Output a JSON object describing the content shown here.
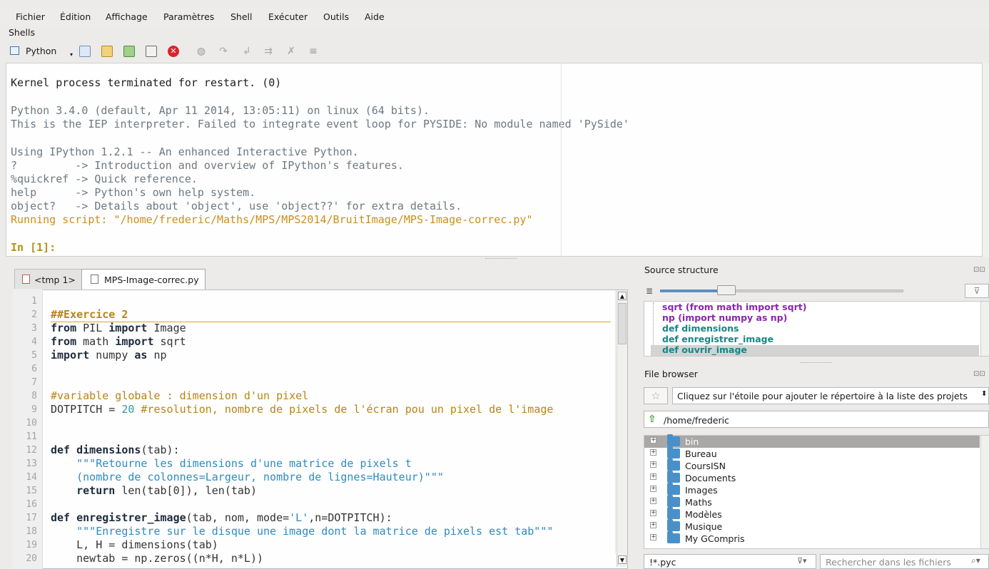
{
  "menu": [
    "Fichier",
    "Édition",
    "Affichage",
    "Paramètres",
    "Shell",
    "Exécuter",
    "Outils",
    "Aide"
  ],
  "shells_label": "Shells",
  "toolbar": {
    "python_label": "Python"
  },
  "shell": {
    "lines": [
      "Kernel process terminated for restart. (0)",
      "Python 3.4.0 (default, Apr 11 2014, 13:05:11) on linux (64 bits).",
      "This is the IEP interpreter. Failed to integrate event loop for PYSIDE: No module named 'PySide'",
      "Using IPython 1.2.1 -- An enhanced Interactive Python.",
      "?         -> Introduction and overview of IPython's features.",
      "%quickref -> Quick reference.",
      "help      -> Python's own help system.",
      "object?   -> Details about 'object', use 'object??' for extra details.",
      "Running script: \"/home/frederic/Maths/MPS/MPS2014/BruitImage/MPS-Image-correc.py\"",
      "In [1]:"
    ]
  },
  "editor": {
    "tabs": [
      "<tmp 1>",
      "MPS-Image-correc.py"
    ],
    "line_numbers": [
      "1",
      "2",
      "3",
      "4",
      "5",
      "6",
      "7",
      "8",
      "9",
      "10",
      "11",
      "12",
      "13",
      "14",
      "15",
      "16",
      "17",
      "18",
      "19",
      "20"
    ],
    "code": {
      "l2": "##Exercice 2",
      "l3a": "from",
      "l3b": " PIL ",
      "l3c": "import",
      "l3d": " Image",
      "l4a": "from",
      "l4b": " math ",
      "l4c": "import",
      "l4d": " sqrt",
      "l5a": "import",
      "l5b": " numpy ",
      "l5c": "as",
      "l5d": " np",
      "l8": "#variable globale : dimension d'un pixel",
      "l9a": "DOTPITCH = ",
      "l9b": "20",
      "l9c": " #resolution, nombre de pixels de l'écran pou un pixel de l'image",
      "l12a": "def ",
      "l12b": "dimensions",
      "l12c": "(tab):",
      "l13": "    \"\"\"Retourne les dimensions d'une matrice de pixels t",
      "l14": "    (nombre de colonnes=Largeur, nombre de lignes=Hauteur)\"\"\"",
      "l15a": "    return",
      "l15b": " len(tab[0]), len(tab)",
      "l17a": "def ",
      "l17b": "enregistrer_image",
      "l17c": "(tab, nom, mode=",
      "l17d": "'L'",
      "l17e": ",n=DOTPITCH):",
      "l18": "    \"\"\"Enregistre sur le disque une image dont la matrice de pixels est tab\"\"\"",
      "l19": "    L, H = dimensions(tab)",
      "l20": "    newtab = np.zeros((n*H, n*L))"
    }
  },
  "source_structure": {
    "title": "Source structure",
    "items": [
      "sqrt (from math import sqrt)",
      "np (import numpy as np)",
      "def dimensions",
      "def enregistrer_image",
      "def ouvrir_image"
    ]
  },
  "file_browser": {
    "title": "File browser",
    "star_hint": "Cliquez sur l'étoile pour ajouter le répertoire à la liste des projets",
    "path": "/home/frederic",
    "folders": [
      "bin",
      "Bureau",
      "CoursISN",
      "Documents",
      "Images",
      "Maths",
      "Modèles",
      "Musique",
      "My GCompris"
    ],
    "filter": "!*.pyc",
    "search_placeholder": "Rechercher dans les fichiers"
  },
  "colors": {
    "accent_orange": "#c98f1e",
    "selection_gray": "#a9a8a7",
    "purple": "#8a25b4",
    "teal": "#158787"
  }
}
